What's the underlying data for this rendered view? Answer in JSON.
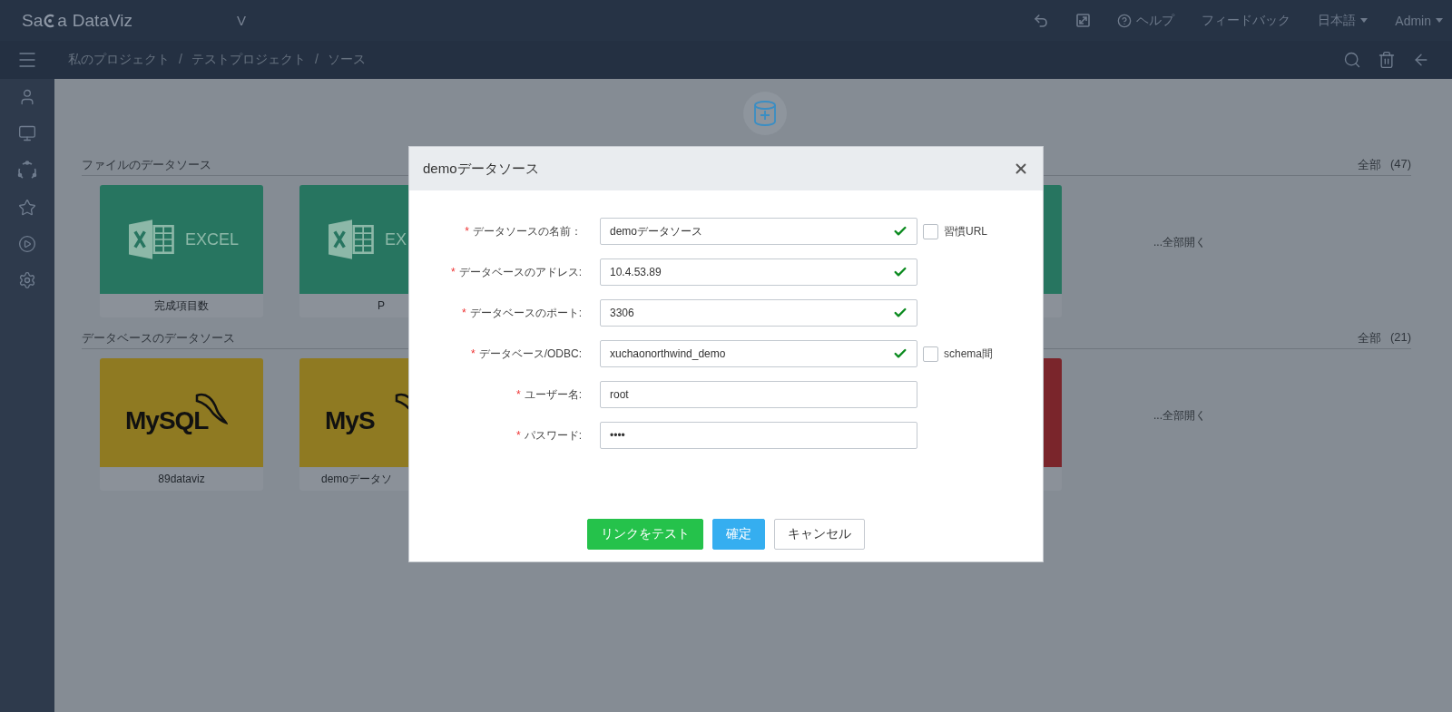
{
  "header": {
    "logo": {
      "prefix": "Sa",
      "suffix": "a",
      "product": "DataViz"
    },
    "project_letter": "V",
    "help": "ヘルプ",
    "feedback": "フィードバック",
    "language": "日本語",
    "user": "Admin"
  },
  "breadcrumb": {
    "separator": "/",
    "items": [
      "私のプロジェクト",
      "テストプロジェクト",
      "ソース"
    ]
  },
  "sections": [
    {
      "title": "ファイルのデータソース",
      "total_label": "全部",
      "count": "(47)",
      "open_all": "...全部開く",
      "cards": [
        {
          "kind": "excel",
          "logo_text": "EXCEL",
          "label": "完成項目数"
        },
        {
          "kind": "excel",
          "logo_text": "EX",
          "label": "P"
        },
        {
          "kind": "excel"
        }
      ]
    },
    {
      "title": "データベースのデータソース",
      "total_label": "全部",
      "count": "(21)",
      "open_all": "...全部開く",
      "cards": [
        {
          "kind": "mysql",
          "logo_text": "MySQL",
          "label": "89dataviz"
        },
        {
          "kind": "mysql",
          "logo_text": "MyS",
          "label": "demoデータソ"
        },
        {
          "kind": "other"
        }
      ]
    }
  ],
  "dialog": {
    "title": "demoデータソース",
    "required_mark": "*",
    "fields": [
      {
        "label": "データソースの名前：",
        "value": "demoデータソース",
        "valid": true,
        "checkbox": {
          "label": "習慣URL",
          "checked": false
        }
      },
      {
        "label": "データベースのアドレス:",
        "value": "10.4.53.89",
        "valid": true
      },
      {
        "label": "データベースのポート:",
        "value": "3306",
        "valid": true
      },
      {
        "label": "データベース/ODBC:",
        "value": "xuchaonorthwind_demo",
        "valid": true,
        "checkbox": {
          "label": "schema間",
          "checked": false
        }
      },
      {
        "label": "ユーザー名:",
        "value": "root",
        "valid": false
      },
      {
        "label": "パスワード:",
        "value": "••••",
        "valid": false
      }
    ],
    "buttons": [
      {
        "label": "リンクをテスト",
        "kind": "success"
      },
      {
        "label": "確定",
        "kind": "primary"
      },
      {
        "label": "キャンセル",
        "kind": "default"
      }
    ]
  }
}
